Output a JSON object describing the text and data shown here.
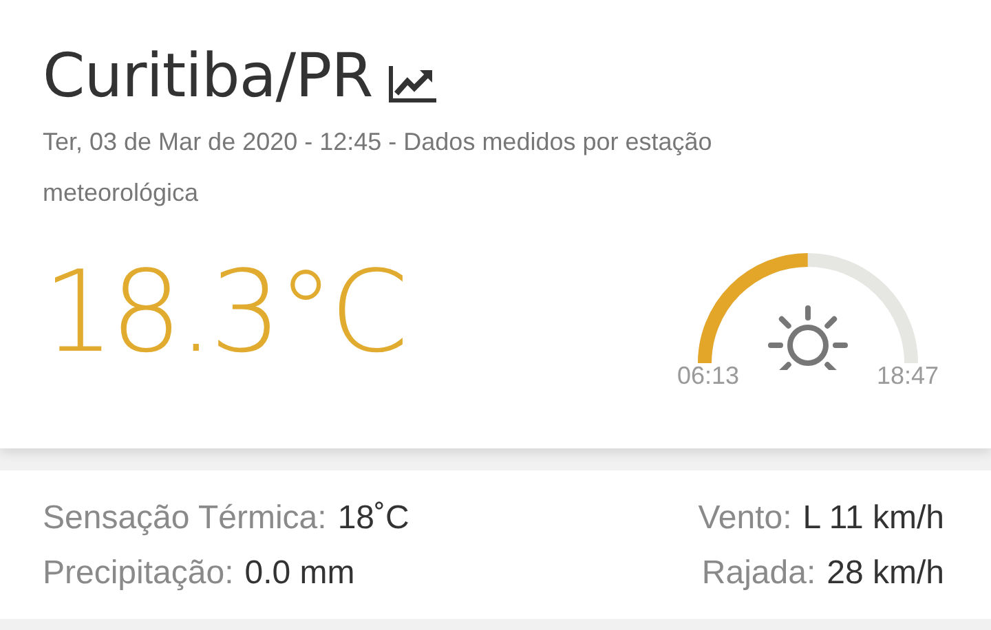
{
  "city": "Curitiba/PR",
  "subtitle": "Ter, 03 de Mar de 2020 - 12:45 - Dados medidos por estação meteorológica",
  "temperature": "18.3°C",
  "sun": {
    "sunrise": "06:13",
    "sunset": "18:47"
  },
  "left_stats": [
    {
      "label": "Sensação Térmica:",
      "value": "18˚C"
    },
    {
      "label": "Precipitação:",
      "value": "0.0 mm"
    }
  ],
  "right_stats": [
    {
      "label": "Vento:",
      "value": "L 11 km/h"
    },
    {
      "label": "Rajada:",
      "value": "28 km/h"
    }
  ]
}
